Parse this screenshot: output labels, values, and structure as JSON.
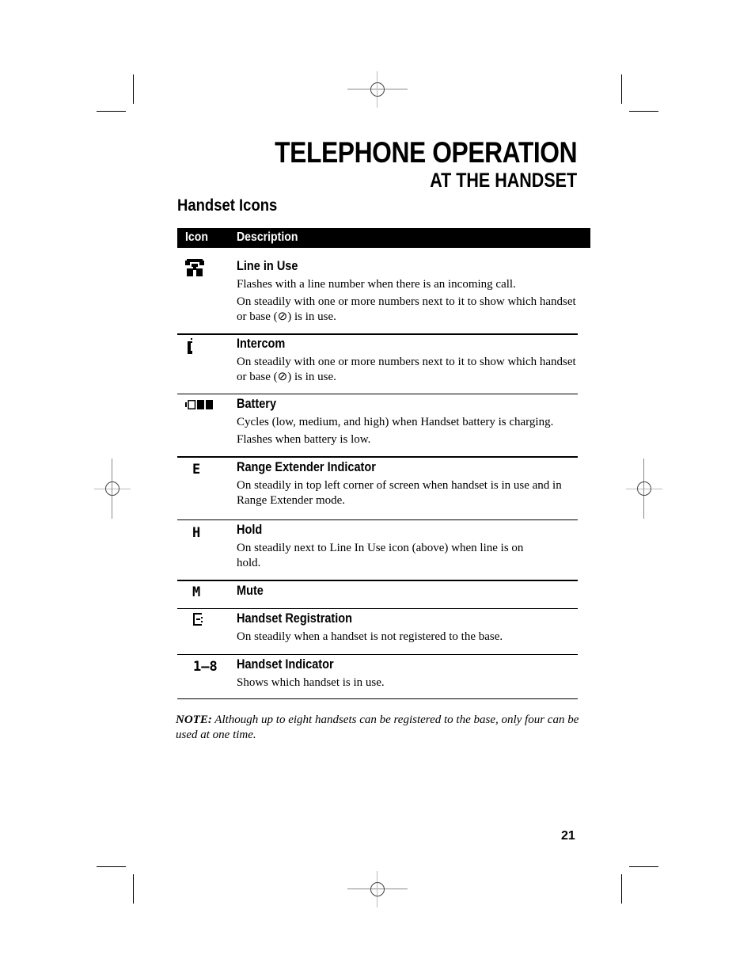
{
  "header": {
    "title": "TELEPHONE OPERATION",
    "subtitle": "AT THE HANDSET"
  },
  "section_title": "Handset Icons",
  "table": {
    "columns": [
      "Icon",
      "Description"
    ],
    "rows": [
      {
        "icon": "line-in-use-icon",
        "name": "Line in Use",
        "desc": [
          "Flashes with a line number when there is an incoming call.",
          "On steadily with one or more numbers next to it to show which handset or base (⊘) is in use."
        ]
      },
      {
        "icon": "intercom-icon",
        "name": "Intercom",
        "desc": [
          "On steadily with one or more numbers next to it to show which handset or base (⊘) is in use."
        ]
      },
      {
        "icon": "battery-icon",
        "name": "Battery",
        "desc": [
          "Cycles (low, medium, and high) when Handset battery is charging.",
          "Flashes when battery is low."
        ]
      },
      {
        "icon": "range-extender-icon",
        "icon_text": "E",
        "name": "Range Extender Indicator",
        "desc": [
          "On steadily in top left corner of screen when handset is in use and in Range Extender mode."
        ]
      },
      {
        "icon": "hold-icon",
        "icon_text": "H",
        "name": "Hold",
        "desc": [
          "On steadily next to Line In Use icon (above) when line is on hold."
        ]
      },
      {
        "icon": "mute-icon",
        "icon_text": "M",
        "name": "Mute",
        "desc": []
      },
      {
        "icon": "handset-registration-icon",
        "name": "Handset Registration",
        "desc": [
          "On steadily when a handset is not registered to the base."
        ]
      },
      {
        "icon": "handset-indicator-icon",
        "icon_text": "1–8",
        "name": "Handset Indicator",
        "desc": [
          "Shows which handset is in use."
        ]
      }
    ]
  },
  "note": {
    "label": "NOTE:",
    "text": " Although up to eight handsets can be registered to the base, only four can be used at one time."
  },
  "page_number": "21"
}
